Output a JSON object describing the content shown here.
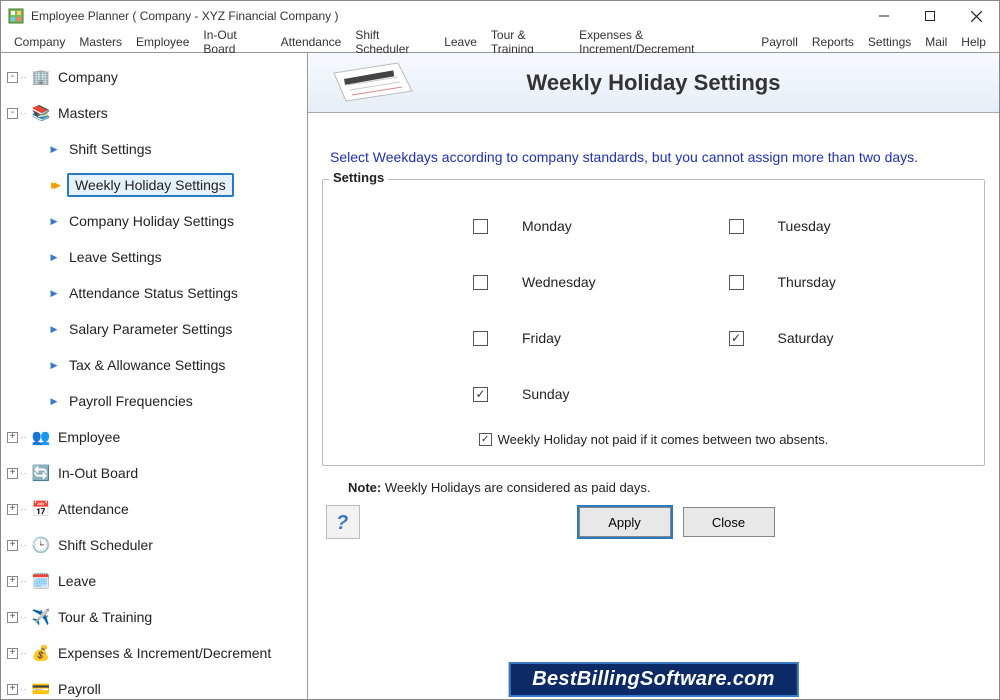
{
  "window": {
    "title": "Employee Planner ( Company - XYZ Financial Company )"
  },
  "menu": [
    "Company",
    "Masters",
    "Employee",
    "In-Out Board",
    "Attendance",
    "Shift Scheduler",
    "Leave",
    "Tour & Training",
    "Expenses & Increment/Decrement",
    "Payroll",
    "Reports",
    "Settings",
    "Mail",
    "Help"
  ],
  "tree": {
    "top": [
      {
        "label": "Company",
        "icon": "🏢",
        "exp": "-"
      },
      {
        "label": "Masters",
        "icon": "📚",
        "exp": "-"
      }
    ],
    "masters_children": [
      {
        "label": "Shift Settings",
        "selected": false
      },
      {
        "label": "Weekly Holiday Settings",
        "selected": true
      },
      {
        "label": "Company Holiday Settings",
        "selected": false
      },
      {
        "label": "Leave Settings",
        "selected": false
      },
      {
        "label": "Attendance Status Settings",
        "selected": false
      },
      {
        "label": "Salary Parameter Settings",
        "selected": false
      },
      {
        "label": "Tax & Allowance Settings",
        "selected": false
      },
      {
        "label": "Payroll Frequencies",
        "selected": false
      }
    ],
    "rest": [
      {
        "label": "Employee",
        "icon": "👥",
        "exp": "+"
      },
      {
        "label": "In-Out Board",
        "icon": "🔄",
        "exp": "+"
      },
      {
        "label": "Attendance",
        "icon": "📅",
        "exp": "+"
      },
      {
        "label": "Shift Scheduler",
        "icon": "🕒",
        "exp": "+"
      },
      {
        "label": "Leave",
        "icon": "🗓️",
        "exp": "+"
      },
      {
        "label": "Tour & Training",
        "icon": "✈️",
        "exp": "+"
      },
      {
        "label": "Expenses & Increment/Decrement",
        "icon": "💰",
        "exp": "+"
      },
      {
        "label": "Payroll",
        "icon": "💳",
        "exp": "+"
      }
    ]
  },
  "panel": {
    "title": "Weekly Holiday Settings",
    "instruction": "Select Weekdays according to company standards, but you cannot assign more than two days.",
    "settings_label": "Settings",
    "days": [
      {
        "label": "Monday",
        "checked": false
      },
      {
        "label": "Tuesday",
        "checked": false
      },
      {
        "label": "Wednesday",
        "checked": false
      },
      {
        "label": "Thursday",
        "checked": false
      },
      {
        "label": "Friday",
        "checked": false
      },
      {
        "label": "Saturday",
        "checked": true
      },
      {
        "label": "Sunday",
        "checked": true
      }
    ],
    "paid_note_checked": true,
    "paid_note_label": "Weekly Holiday not paid if it comes between two absents.",
    "note_label": "Note:",
    "note_text": "Weekly Holidays are considered as paid days.",
    "apply_label": "Apply",
    "close_label": "Close"
  },
  "footer": "BestBillingSoftware.com"
}
